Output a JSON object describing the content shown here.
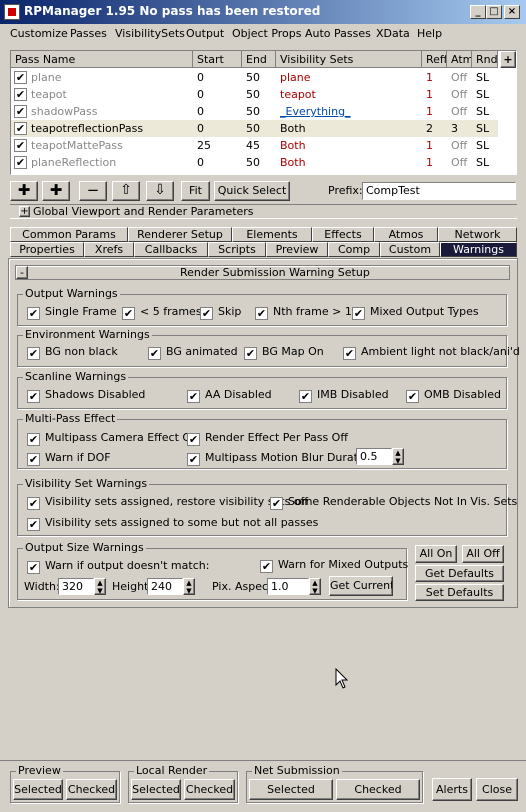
{
  "window": {
    "title": "RPManager 1.95   No pass has been restored"
  },
  "menu": [
    "Customize",
    "Passes",
    "VisibilitySets",
    "Output",
    "Object Props",
    "Auto Passes",
    "XData",
    "Help"
  ],
  "list": {
    "headers": {
      "name": "Pass Name",
      "start": "Start",
      "end": "End",
      "vis": "Visibility Sets",
      "reff": "Reff",
      "atm": "Atm",
      "rndr": "Rndr",
      "scroll": "+"
    },
    "rows": [
      {
        "name": "plane",
        "start": "0",
        "end": "50",
        "vis": "plane",
        "reff": "1",
        "atm": "Off",
        "rndr": "SL",
        "style": "gray",
        "visStyle": "red"
      },
      {
        "name": "teapot",
        "start": "0",
        "end": "50",
        "vis": "teapot",
        "reff": "1",
        "atm": "Off",
        "rndr": "SL",
        "style": "gray",
        "visStyle": "red"
      },
      {
        "name": "shadowPass",
        "start": "0",
        "end": "50",
        "vis": "_Everything_",
        "reff": "1",
        "atm": "Off",
        "rndr": "SL",
        "style": "gray",
        "visStyle": "blue"
      },
      {
        "name": "teapotreflectionPass",
        "start": "0",
        "end": "50",
        "vis": "Both",
        "reff": "2",
        "atm": "3",
        "rndr": "SL",
        "style": "black",
        "visStyle": "black"
      },
      {
        "name": "teapotMattePass",
        "start": "25",
        "end": "45",
        "vis": "Both",
        "reff": "1",
        "atm": "Off",
        "rndr": "SL",
        "style": "gray",
        "visStyle": "red"
      },
      {
        "name": "planeReflection",
        "start": "0",
        "end": "50",
        "vis": "Both",
        "reff": "1",
        "atm": "Off",
        "rndr": "SL",
        "style": "gray",
        "visStyle": "red"
      }
    ]
  },
  "toolbar": {
    "fit": "Fit",
    "quick_select": "Quick Select",
    "prefix_label": "Prefix:",
    "prefix_value": "CompTest"
  },
  "global_viewport": {
    "toggle": "+",
    "label": "Global Viewport and Render Parameters"
  },
  "tabs_row1": [
    "Common Params",
    "Renderer Setup",
    "Elements",
    "Effects",
    "Atmos",
    "Network"
  ],
  "tabs_row2": [
    "Properties",
    "Xrefs",
    "Callbacks",
    "Scripts",
    "Preview",
    "Comp",
    "Custom",
    "Warnings"
  ],
  "panel": {
    "toggle": "-",
    "title": "Render Submission Warning Setup"
  },
  "groups": {
    "output": {
      "label": "Output Warnings",
      "items": [
        "Single Frame",
        "< 5 frames",
        "Skip",
        "Nth frame > 1",
        "Mixed Output Types"
      ]
    },
    "environment": {
      "label": "Environment Warnings",
      "items": [
        "BG non black",
        "BG animated",
        "BG Map On",
        "Ambient light not black/ani'd"
      ]
    },
    "scanline": {
      "label": "Scanline Warnings",
      "items": [
        "Shadows Disabled",
        "AA Disabled",
        "IMB Disabled",
        "OMB Disabled"
      ]
    },
    "multipass": {
      "label": "Multi-Pass Effect",
      "items": [
        "Multipass Camera Effect Off",
        "Render Effect Per Pass Off",
        "Warn if DOF",
        "Multipass Motion Blur Duration:"
      ],
      "duration": "0.5"
    },
    "visibility": {
      "label": "Visibility Set Warnings",
      "items": [
        "Visibility sets assigned, restore visibility sets off",
        "Some Renderable Objects Not In Vis. Sets",
        "Visibility sets assigned to some but not all passes"
      ]
    },
    "outsize": {
      "label": "Output Size Warnings",
      "warn_match": "Warn if output doesn't match:",
      "warn_mixed": "Warn for Mixed Outputs",
      "width_label": "Width:",
      "width": "320",
      "height_label": "Height:",
      "height": "240",
      "aspect_label": "Pix. Aspect",
      "aspect": "1.0",
      "get_current": "Get Current"
    }
  },
  "side_buttons": {
    "all_on": "All On",
    "all_off": "All Off",
    "get_defaults": "Get Defaults",
    "set_defaults": "Set Defaults"
  },
  "bottom": {
    "preview": {
      "label": "Preview",
      "selected": "Selected",
      "checked": "Checked"
    },
    "local": {
      "label": "Local Render",
      "selected": "Selected",
      "checked": "Checked"
    },
    "net": {
      "label": "Net Submission",
      "selected": "Selected",
      "checked": "Checked"
    },
    "alerts": "Alerts",
    "close": "Close"
  },
  "colors": {
    "title_start": "#0a246a",
    "title_end": "#a6caf0",
    "active_tab": "#1a1a3a",
    "red_text": "#a00000",
    "blue_text": "#004aa8"
  }
}
